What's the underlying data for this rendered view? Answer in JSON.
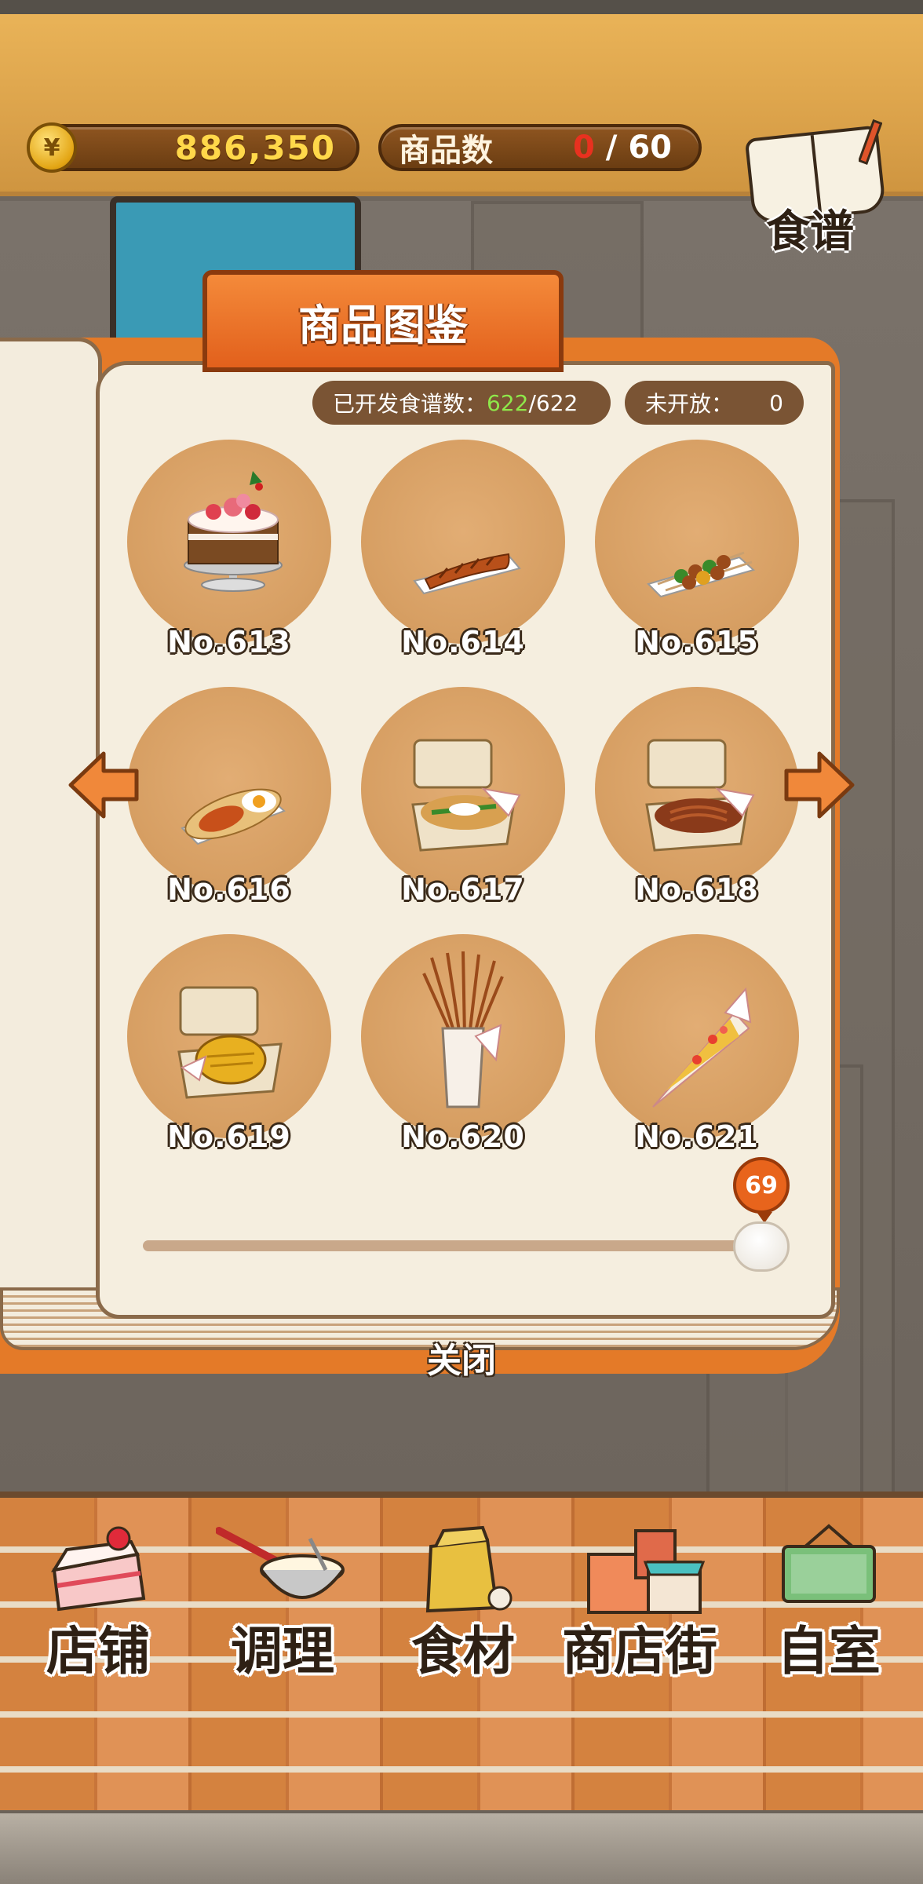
{
  "header": {
    "currency_symbol": "¥",
    "money": "886,350",
    "product_count_label": "商品数",
    "product_count_current": "0",
    "product_count_sep": "/",
    "product_count_max": "60",
    "recipe_label": "食谱"
  },
  "dialog": {
    "title": "商品图鉴",
    "developed_label": "已开发食谱数：",
    "developed_current": "622",
    "developed_total": "/622",
    "locked_label": "未开放：",
    "locked_value": "0",
    "items": [
      {
        "num": "No.613",
        "icon": "christmas-cake"
      },
      {
        "num": "No.614",
        "icon": "grilled-eel"
      },
      {
        "num": "No.615",
        "icon": "yakitori-skewers"
      },
      {
        "num": "No.616",
        "icon": "omelet-flatbread"
      },
      {
        "num": "No.617",
        "icon": "okonomiyaki-box"
      },
      {
        "num": "No.618",
        "icon": "yakisoba-box"
      },
      {
        "num": "No.619",
        "icon": "baked-potato-box"
      },
      {
        "num": "No.620",
        "icon": "pretzel-sticks-cup"
      },
      {
        "num": "No.621",
        "icon": "popcorn-cone"
      }
    ],
    "page_value": "69",
    "close_label": "关闭"
  },
  "nav": [
    {
      "label": "店铺",
      "icon": "cake-icon"
    },
    {
      "label": "调理",
      "icon": "mixing-bowl-icon"
    },
    {
      "label": "食材",
      "icon": "ingredient-bag-icon"
    },
    {
      "label": "商店街",
      "icon": "shop-street-icon"
    },
    {
      "label": "自室",
      "icon": "staff-only-sign-icon"
    }
  ],
  "colors": {
    "accent": "#e2601c",
    "header": "#dba24a",
    "pill": "#7a5434",
    "circle": "#d69e62"
  }
}
